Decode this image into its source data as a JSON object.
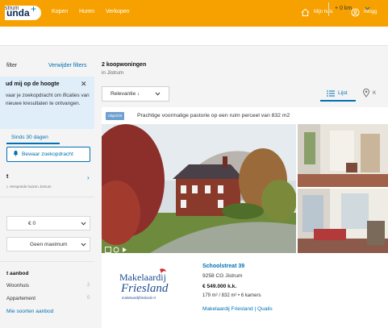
{
  "header": {
    "logo_text": "unda",
    "nav": [
      {
        "label": "Kopen"
      },
      {
        "label": "Huren"
      },
      {
        "label": "Verkopen"
      }
    ],
    "my_house_label": "Mijn huis",
    "login_label": "Inlogg"
  },
  "search": {
    "location": "strum",
    "radius": "+ 0 km"
  },
  "sidebar": {
    "filter_label": "filter",
    "clear_filters": "Verwijder filters",
    "alert_title": "ud mij op de hoogte",
    "alert_text": "vaar je zoekopdracht om ificaties van nieuwe kresultaten te ontvangen.",
    "since_tab": "Sinds 30 dagen",
    "save_search": "Bewaar zoekopdracht",
    "location_head": "t",
    "location_sub": "r, Verspreide huizen Jistrum",
    "price_min": "€ 0",
    "price_max": "Geen maximum",
    "aanbod_head": "t aanbod",
    "aanbod": [
      {
        "label": "Woonhuis",
        "count": "2"
      },
      {
        "label": "Appartement",
        "count": "0"
      }
    ],
    "more_types": "Mie soorten aanbod"
  },
  "results": {
    "count_label": "2 koopwoningen",
    "location_label": "in Jistrum",
    "sort_label": "Relevantie",
    "view_list": "Lijst",
    "view_map": "K"
  },
  "listing": {
    "badge": "Uitgelicht",
    "promo_text": "Prachtige voormalige pastorie op een ruim perceel van 832 m2",
    "agent_logo_line1": "Makelaardij",
    "agent_logo_line2": "Friesland",
    "agent_logo_url": "makelaardijfriesland.nl",
    "street": "Schoolstreat 39",
    "zip_city": "9258 CG Jistrum",
    "price": "€ 549.000 k.k.",
    "details": "179 m² / 832 m² • 6 kamers",
    "agent_name": "Makelaardij Friesland | Qualis"
  },
  "colors": {
    "brand_orange": "#f7a100",
    "link_blue": "#0071b3",
    "alert_bg": "#e0eefa"
  }
}
